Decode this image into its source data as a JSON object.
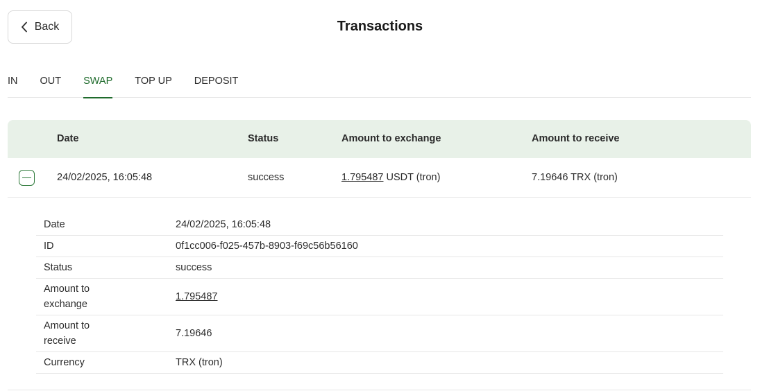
{
  "header": {
    "back_label": "Back",
    "title": "Transactions"
  },
  "tabs": [
    {
      "label": "IN",
      "active": false
    },
    {
      "label": "OUT",
      "active": false
    },
    {
      "label": "SWAP",
      "active": true
    },
    {
      "label": "TOP UP",
      "active": false
    },
    {
      "label": "DEPOSIT",
      "active": false
    }
  ],
  "table": {
    "columns": {
      "date": "Date",
      "status": "Status",
      "amount_to_exchange": "Amount to exchange",
      "amount_to_receive": "Amount to receive"
    },
    "rows": [
      {
        "date": "24/02/2025, 16:05:48",
        "status": "success",
        "exchange_amount": "1.795487",
        "exchange_currency": "USDT (tron)",
        "receive": "7.19646 TRX (tron)"
      }
    ]
  },
  "details": {
    "rows": [
      {
        "label": "Date",
        "value": "24/02/2025, 16:05:48"
      },
      {
        "label": "ID",
        "value": "0f1cc006-f025-457b-8903-f69c56b56160"
      },
      {
        "label": "Status",
        "value": "success"
      },
      {
        "label": "Amount to exchange",
        "value": "1.795487"
      },
      {
        "label": "Amount to receive",
        "value": "7.19646"
      },
      {
        "label": "Currency",
        "value": "TRX (tron)"
      }
    ]
  },
  "colors": {
    "accent": "#1f6b2c",
    "header_bg": "#e8f1e8",
    "border": "#e6e6e6"
  }
}
